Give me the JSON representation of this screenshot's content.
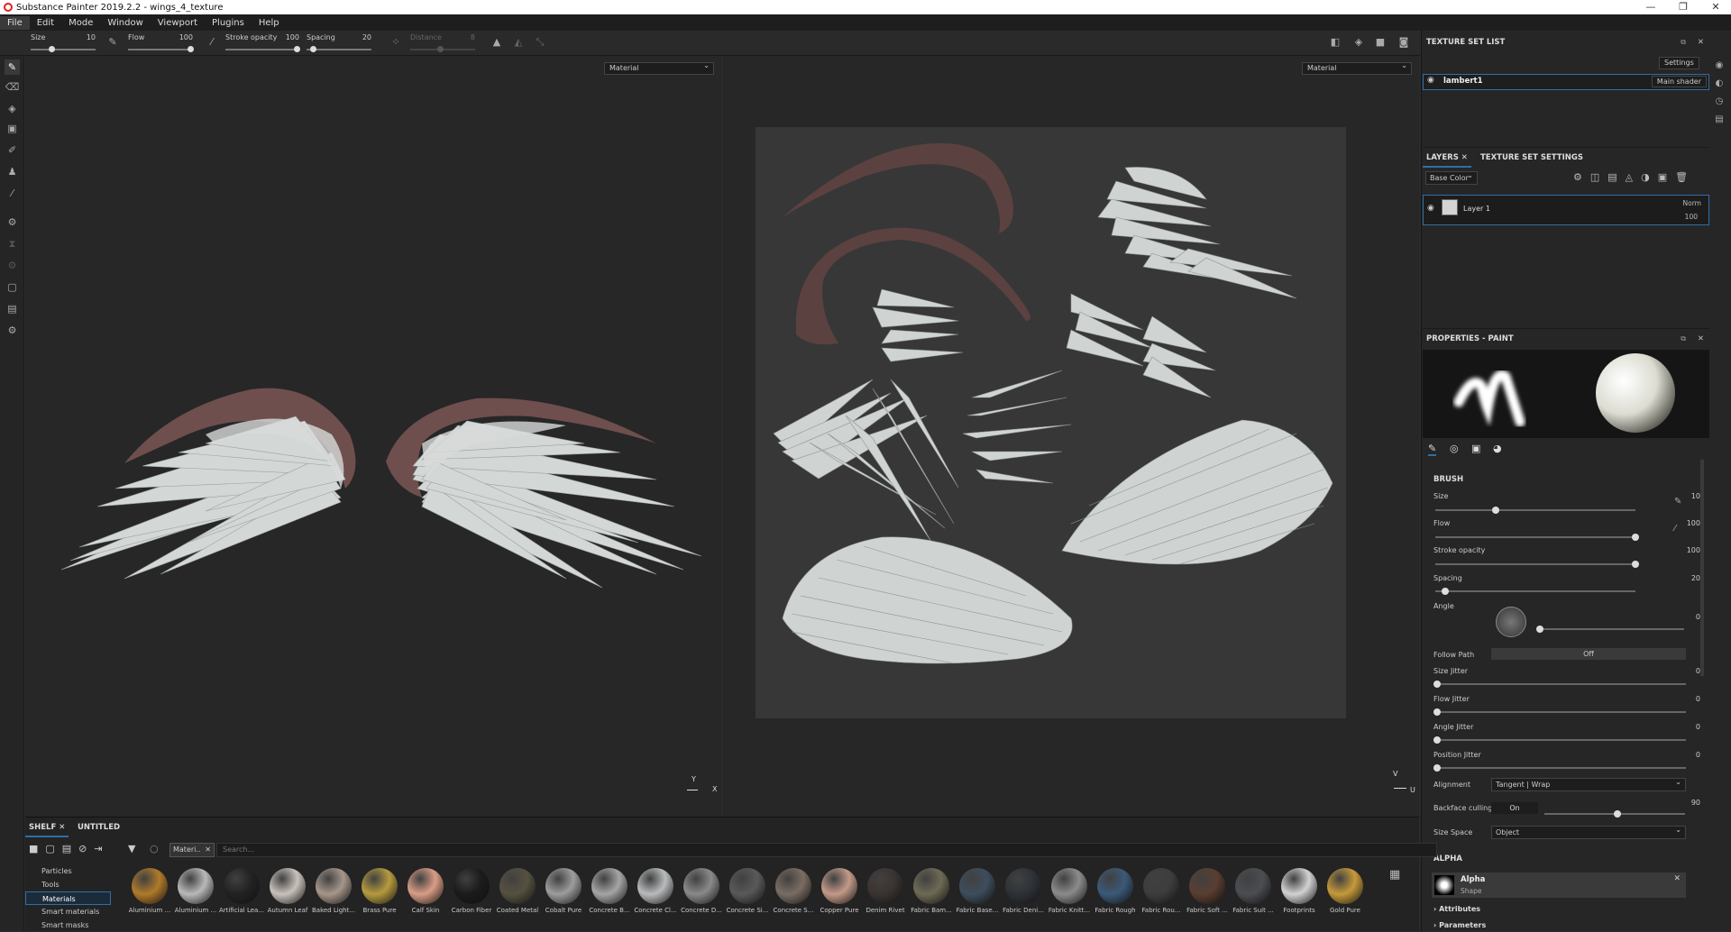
{
  "titlebar": {
    "title": "Substance Painter 2019.2.2 - wings_4_texture",
    "minimize": "—",
    "maximize": "❐",
    "close": "✕"
  },
  "menu": [
    "File",
    "Edit",
    "Mode",
    "Window",
    "Viewport",
    "Plugins",
    "Help"
  ],
  "tooloptions": {
    "size": {
      "label": "Size",
      "value": "10"
    },
    "flow": {
      "label": "Flow",
      "value": "100"
    },
    "stroke_opacity": {
      "label": "Stroke opacity",
      "value": "100"
    },
    "spacing": {
      "label": "Spacing",
      "value": "20"
    },
    "distance": {
      "label": "Distance",
      "value": "8"
    }
  },
  "viewports": {
    "left_mode": "Material",
    "right_mode": "Material",
    "left_axes": {
      "y": "Y",
      "x": "X"
    },
    "right_axes": {
      "v": "V",
      "u": "U"
    }
  },
  "texture_set_list": {
    "title": "TEXTURE SET LIST",
    "settings": "Settings",
    "item_name": "lambert1",
    "shader": "Main shader"
  },
  "layers": {
    "tab_layers": "LAYERS",
    "tab_tss": "TEXTURE SET SETTINGS",
    "channel": "Base Color",
    "layer_name": "Layer 1",
    "blend": "Norm",
    "opacity": "100"
  },
  "properties": {
    "title": "PROPERTIES - PAINT",
    "brush_header": "BRUSH",
    "size": {
      "label": "Size",
      "value": "10",
      "level": 0.3
    },
    "flow": {
      "label": "Flow",
      "value": "100",
      "level": 1.0
    },
    "stroke_opacity": {
      "label": "Stroke opacity",
      "value": "100",
      "level": 1.0
    },
    "spacing": {
      "label": "Spacing",
      "value": "20",
      "level": 0.05
    },
    "angle": {
      "label": "Angle",
      "value": "0"
    },
    "follow_path": {
      "label": "Follow Path",
      "value": "Off"
    },
    "size_jitter": {
      "label": "Size Jitter",
      "value": "0"
    },
    "flow_jitter": {
      "label": "Flow Jitter",
      "value": "0"
    },
    "angle_jitter": {
      "label": "Angle Jitter",
      "value": "0"
    },
    "position_jitter": {
      "label": "Position Jitter",
      "value": "0"
    },
    "alignment": {
      "label": "Alignment",
      "value": "Tangent | Wrap"
    },
    "backface": {
      "label": "Backface culling",
      "toggle": "On",
      "value": "90"
    },
    "size_space": {
      "label": "Size Space",
      "value": "Object"
    },
    "alpha_header": "ALPHA",
    "alpha_name": "Alpha",
    "alpha_sub": "Shape",
    "attributes": "Attributes",
    "parameters": "Parameters"
  },
  "shelf": {
    "tab_shelf": "SHELF",
    "tab_untitled": "UNTITLED",
    "filter_chip": "Materi..",
    "search_placeholder": "Search...",
    "categories": [
      "Particles",
      "Tools",
      "Materials",
      "Smart materials",
      "Smart masks"
    ],
    "materials": [
      {
        "name": "Aluminium ...",
        "color": "#b07a2a"
      },
      {
        "name": "Aluminium ...",
        "color": "#b9b9b9"
      },
      {
        "name": "Artificial Lea...",
        "color": "#222222"
      },
      {
        "name": "Autumn Leaf",
        "color": "#c9c2bb"
      },
      {
        "name": "Baked Light...",
        "color": "#a6968a"
      },
      {
        "name": "Brass Pure",
        "color": "#b59b3e"
      },
      {
        "name": "Calf Skin",
        "color": "#d99d86"
      },
      {
        "name": "Carbon Fiber",
        "color": "#1b1b1b"
      },
      {
        "name": "Coated Metal",
        "color": "#56513f"
      },
      {
        "name": "Cobalt Pure",
        "color": "#9d9d9d"
      },
      {
        "name": "Concrete B...",
        "color": "#a5a5a5"
      },
      {
        "name": "Concrete Cl...",
        "color": "#b9bcbd"
      },
      {
        "name": "Concrete D...",
        "color": "#8a8a8a"
      },
      {
        "name": "Concrete Si...",
        "color": "#595959"
      },
      {
        "name": "Concrete S...",
        "color": "#7a6d63"
      },
      {
        "name": "Copper Pure",
        "color": "#c39a88"
      },
      {
        "name": "Denim Rivet",
        "color": "#3a3330"
      },
      {
        "name": "Fabric Bam...",
        "color": "#6e6a55"
      },
      {
        "name": "Fabric Base...",
        "color": "#3e4d5c"
      },
      {
        "name": "Fabric Deni...",
        "color": "#2e3238"
      },
      {
        "name": "Fabric Knitt...",
        "color": "#8c8c8c"
      },
      {
        "name": "Fabric Rough",
        "color": "#3b5978"
      },
      {
        "name": "Fabric Rou...",
        "color": "#3d3d3d"
      },
      {
        "name": "Fabric Soft ...",
        "color": "#5a3e30"
      },
      {
        "name": "Fabric Suit ...",
        "color": "#4a4d52"
      },
      {
        "name": "Footprints",
        "color": "#d2d2d2"
      },
      {
        "name": "Gold Pure",
        "color": "#c69a3a"
      }
    ]
  }
}
